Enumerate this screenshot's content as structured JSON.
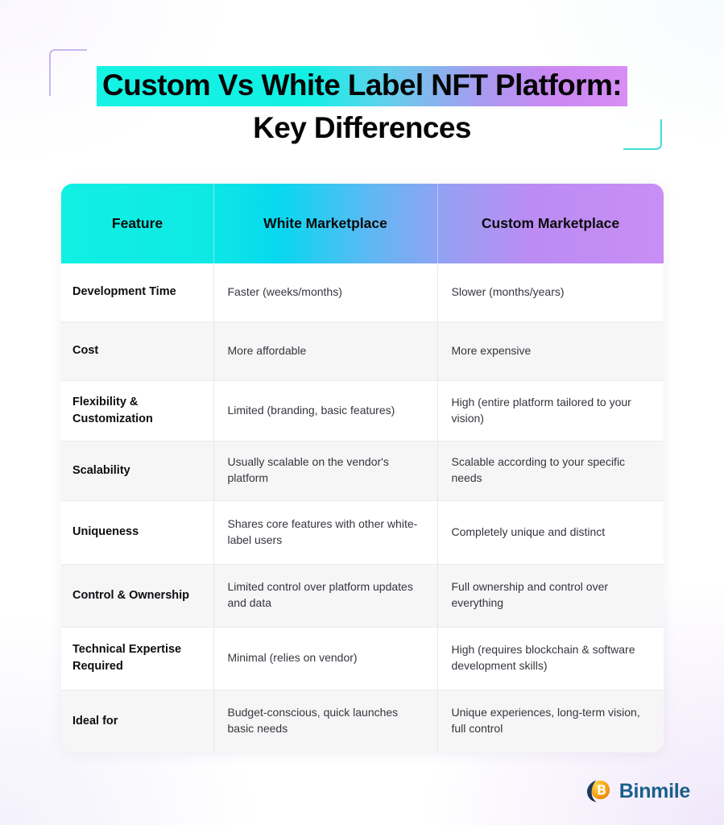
{
  "title": {
    "line1": "Custom Vs White Label NFT Platform:",
    "line2": "Key Differences"
  },
  "table": {
    "headers": {
      "feature": "Feature",
      "white": "White Marketplace",
      "custom": "Custom Marketplace"
    },
    "rows": [
      {
        "feature": "Development Time",
        "white": "Faster (weeks/months)",
        "custom": "Slower (months/years)"
      },
      {
        "feature": "Cost",
        "white": "More affordable",
        "custom": "More expensive"
      },
      {
        "feature": "Flexibility & Customization",
        "white": "Limited (branding, basic features)",
        "custom": "High (entire platform tailored to your vision)"
      },
      {
        "feature": "Scalability",
        "white": "Usually scalable on the vendor's platform",
        "custom": "Scalable according to your specific needs"
      },
      {
        "feature": "Uniqueness",
        "white": "Shares core features with other white-label users",
        "custom": "Completely unique and distinct"
      },
      {
        "feature": "Control & Ownership",
        "white": "Limited control over platform updates and data",
        "custom": "Full ownership and control over everything"
      },
      {
        "feature": "Technical Expertise Required",
        "white": "Minimal (relies on vendor)",
        "custom": "High (requires blockchain & software development skills)"
      },
      {
        "feature": "Ideal for",
        "white": "Budget-conscious, quick launches basic needs",
        "custom": "Unique experiences, long-term vision, full control"
      }
    ]
  },
  "brand": {
    "name": "Binmile",
    "mark_letter": "B"
  },
  "colors": {
    "header_gradient_start": "#11F0E3",
    "header_gradient_mid": "#62B7F3",
    "header_gradient_end": "#C88EF5",
    "title_highlight_start": "#14F3E4",
    "title_highlight_end": "#D78EF4",
    "bracket_top_left": "#C9B7EE",
    "bracket_bottom_right": "#3DDFD8",
    "row_stripe": "#F6F6F7",
    "brand_text": "#1A5F8A",
    "brand_mark_navy": "#1B3A63",
    "brand_mark_gold": "#F5A623"
  }
}
